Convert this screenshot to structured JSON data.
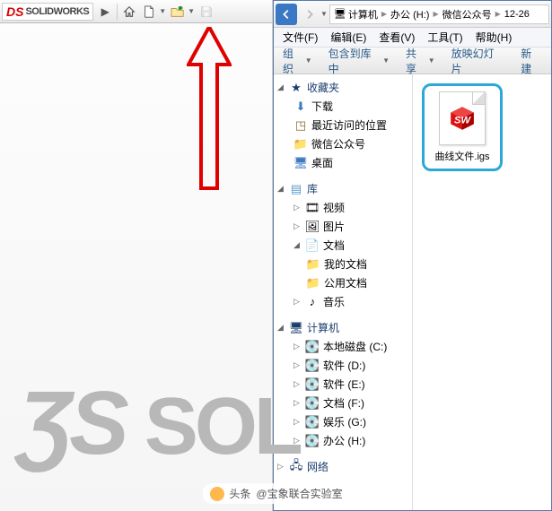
{
  "solidworks": {
    "brand_prefix": "DS",
    "brand_name": "SOLIDWORKS",
    "watermark": "DS SOL"
  },
  "toolbar": {
    "expand": "▶",
    "home": "home-icon",
    "new": "new-doc-icon",
    "open": "open-icon",
    "save": "save-icon"
  },
  "explorer": {
    "breadcrumb": {
      "computer_icon": "🖥",
      "computer": "计算机",
      "drive": "办公 (H:)",
      "folder1": "微信公众号",
      "folder2": "12-26"
    },
    "menu": {
      "file": "文件(F)",
      "edit": "编辑(E)",
      "view": "查看(V)",
      "tools": "工具(T)",
      "help": "帮助(H)"
    },
    "cmd": {
      "organize": "组织",
      "include": "包含到库中",
      "share": "共享",
      "slideshow": "放映幻灯片",
      "new": "新建"
    },
    "tree": {
      "favorites": "收藏夹",
      "downloads": "下载",
      "recent": "最近访问的位置",
      "wechat": "微信公众号",
      "desktop": "桌面",
      "libraries": "库",
      "videos": "视频",
      "pictures": "图片",
      "documents": "文档",
      "my_docs": "我的文档",
      "public_docs": "公用文档",
      "music": "音乐",
      "computer": "计算机",
      "local_c": "本地磁盘 (C:)",
      "drive_d": "软件 (D:)",
      "drive_e": "软件 (E:)",
      "drive_f": "文档 (F:)",
      "drive_g": "娱乐 (G:)",
      "drive_h": "办公 (H:)",
      "network": "网络"
    },
    "file": {
      "name": "曲线文件.igs",
      "badge": "SW"
    }
  },
  "footer": {
    "prefix": "头条",
    "author": "@宝象联合实验室"
  }
}
